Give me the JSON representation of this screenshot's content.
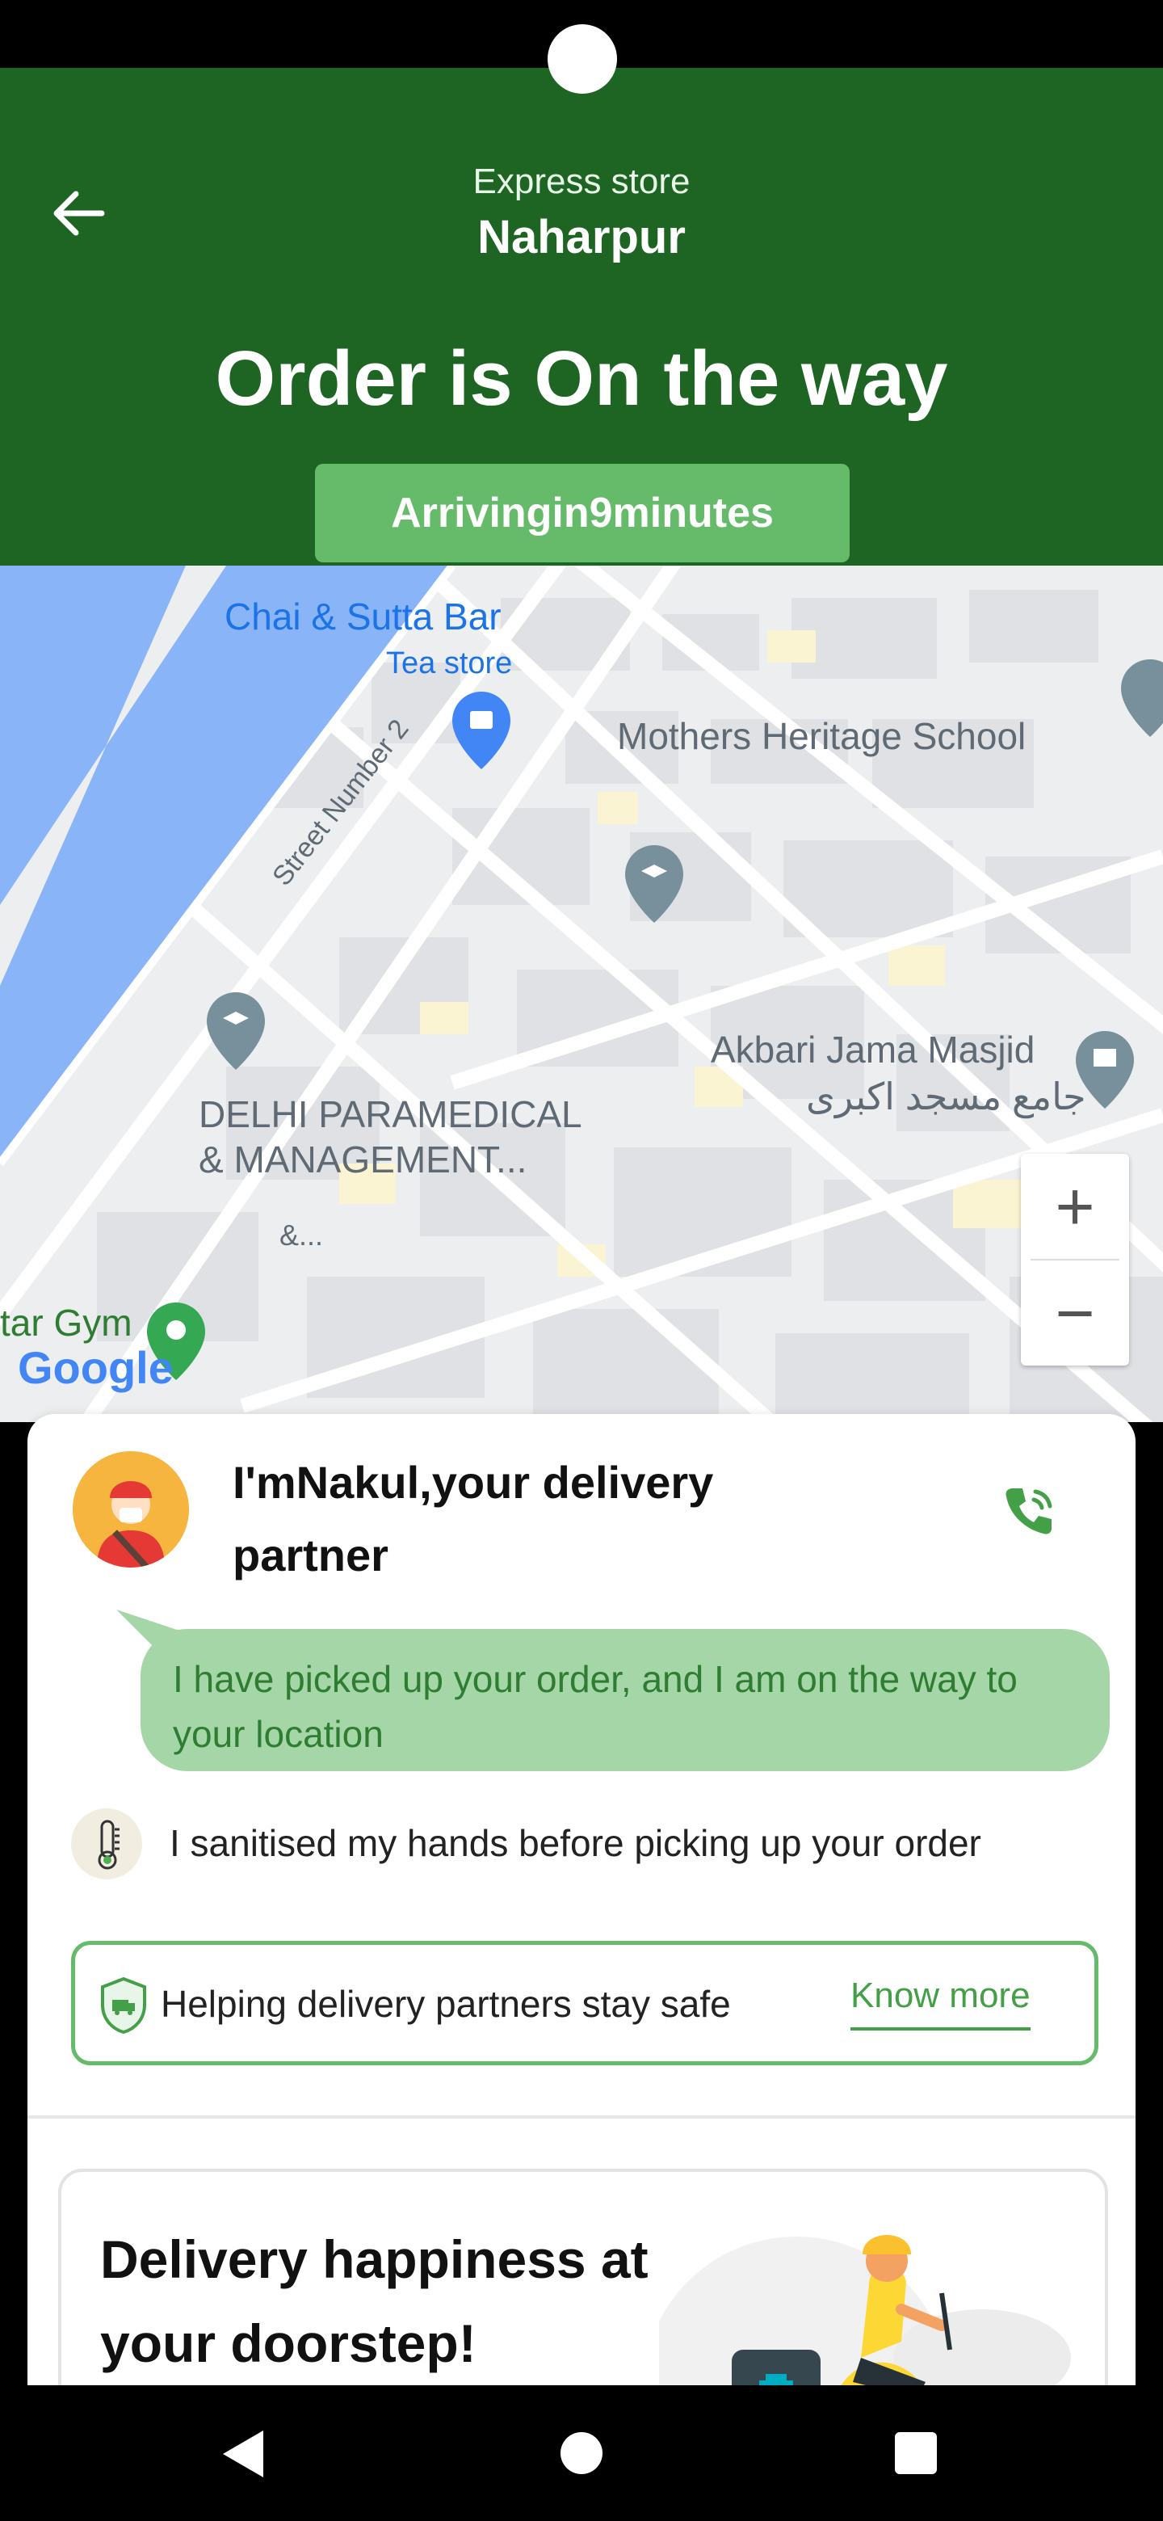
{
  "header": {
    "store_subtitle": "Express store",
    "store_name": "Naharpur",
    "order_status": "Order is On the way",
    "eta": "Arrivingin9minutes"
  },
  "map": {
    "labels": {
      "cafe": "Chai & Sutta Bar",
      "cafe_type": "Tea store",
      "school": "Mothers Heritage School",
      "street": "Street Number 2",
      "mosque": "Akbari Jama Masjid",
      "mosque_local": "جامع مسجد اکبری",
      "institute_line1": "DELHI PARAMEDICAL",
      "institute_line2": "& MANAGEMENT...",
      "institute_line3": "&...",
      "gym": "tar Gym",
      "google": "Google"
    },
    "zoom_in": "+",
    "zoom_out": "−"
  },
  "partner": {
    "intro": "I'mNakul,your delivery partner",
    "message": "I have picked up your order, and I am on the way to your location",
    "hygiene": "I sanitised my hands before picking up your order",
    "safety_text": "Helping delivery partners stay safe",
    "know_more": "Know more"
  },
  "promo": {
    "title": "Delivery happiness at your doorstep!"
  },
  "colors": {
    "header_bg": "#1e6423",
    "eta_bg": "#66bb6a",
    "bubble_bg": "#a5d6a7",
    "accent": "#43a047",
    "map_water": "#8ab4f8"
  }
}
